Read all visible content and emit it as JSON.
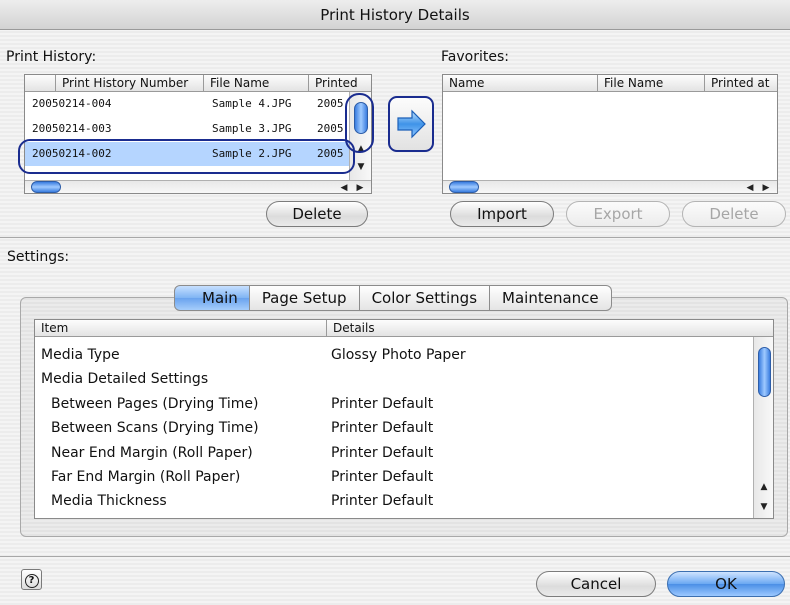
{
  "window": {
    "title": "Print History Details"
  },
  "print_history": {
    "label": "Print History:",
    "columns": [
      "Print History Number",
      "File Name",
      "Printed"
    ],
    "rows": [
      {
        "number": "20050214-004",
        "file": "Sample 4.JPG",
        "printed": "2005"
      },
      {
        "number": "20050214-003",
        "file": "Sample 3.JPG",
        "printed": "2005"
      },
      {
        "number": "20050214-002",
        "file": "Sample 2.JPG",
        "printed": "2005"
      }
    ],
    "selected_index": 2,
    "delete_label": "Delete"
  },
  "transfer": {
    "icon": "arrow-right-icon"
  },
  "favorites": {
    "label": "Favorites:",
    "columns": [
      "Name",
      "File Name",
      "Printed at"
    ],
    "import_label": "Import",
    "export_label": "Export",
    "delete_label": "Delete"
  },
  "settings": {
    "label": "Settings:",
    "tabs": [
      "Main",
      "Page Setup",
      "Color Settings",
      "Maintenance"
    ],
    "active_tab": "Main",
    "columns": [
      "Item",
      "Details"
    ],
    "rows": [
      {
        "item": "Media Type",
        "details": "Glossy Photo Paper",
        "indent": false
      },
      {
        "item": "Media Detailed Settings",
        "details": "",
        "indent": false
      },
      {
        "item": "Between Pages (Drying Time)",
        "details": "Printer Default",
        "indent": true
      },
      {
        "item": "Between Scans (Drying Time)",
        "details": "Printer Default",
        "indent": true
      },
      {
        "item": "Near End Margin (Roll Paper)",
        "details": "Printer Default",
        "indent": true
      },
      {
        "item": "Far End Margin (Roll Paper)",
        "details": "Printer Default",
        "indent": true
      },
      {
        "item": "Media Thickness",
        "details": "Printer Default",
        "indent": true
      }
    ]
  },
  "footer": {
    "help_icon": "help-icon",
    "cancel_label": "Cancel",
    "ok_label": "OK"
  },
  "colors": {
    "selection": "#b5d5ff",
    "accent": "#4b8fe6",
    "highlight_ring": "#1a2c8f"
  }
}
